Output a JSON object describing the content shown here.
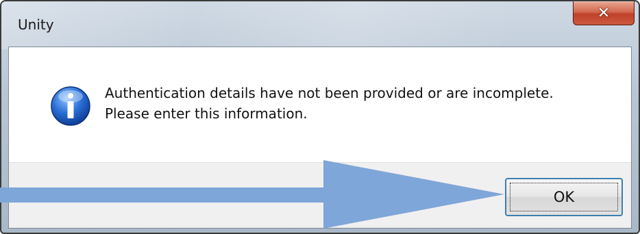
{
  "window": {
    "title": "Unity",
    "close_icon": "close-icon"
  },
  "dialog": {
    "icon": "info-icon",
    "message_line1": "Authentication details have not been provided or are incomplete.",
    "message_line2": "Please enter this information."
  },
  "buttons": {
    "ok_label": "OK"
  },
  "annotation": {
    "arrow_color": "#7ea6d8",
    "arrow_icon": "arrow-right-icon"
  }
}
